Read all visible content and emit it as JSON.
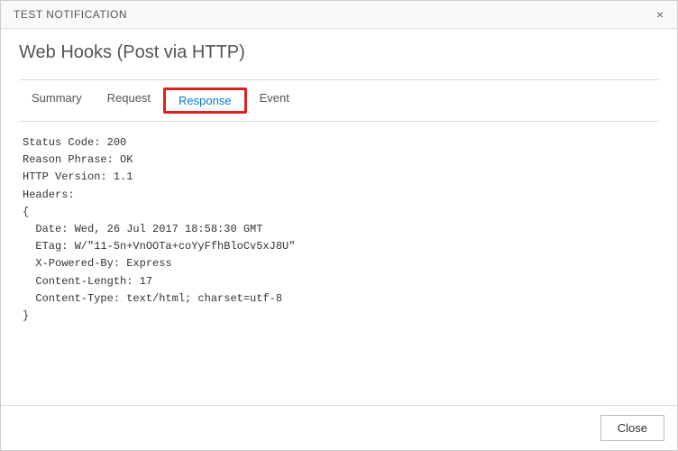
{
  "titlebar": {
    "title": "TEST NOTIFICATION",
    "close_glyph": "×"
  },
  "heading": "Web Hooks (Post via HTTP)",
  "tabs": {
    "summary": "Summary",
    "request": "Request",
    "response": "Response",
    "event": "Event",
    "active": "response"
  },
  "response": {
    "status_line": "Status Code: 200",
    "reason_line": "Reason Phrase: OK",
    "version_line": "HTTP Version: 1.1",
    "headers_label": "Headers:",
    "open_brace": "{",
    "header_date": "  Date: Wed, 26 Jul 2017 18:58:30 GMT",
    "header_etag": "  ETag: W/\"11-5n+VnOOTa+coYyFfhBloCv5xJ8U\"",
    "header_xpowered": "  X-Powered-By: Express",
    "header_contentlength": "  Content-Length: 17",
    "header_contenttype": "  Content-Type: text/html; charset=utf-8",
    "close_brace": "}"
  },
  "footer": {
    "close_label": "Close"
  }
}
